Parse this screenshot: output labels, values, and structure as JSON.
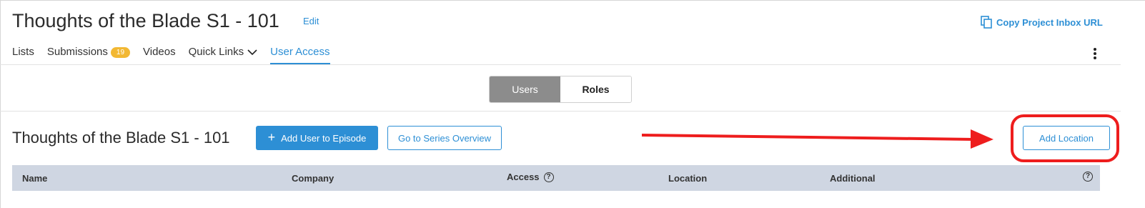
{
  "header": {
    "title": "Thoughts of the Blade S1 - 101",
    "edit_label": "Edit",
    "copy_label": "Copy Project Inbox URL",
    "copy_icon": "copy-icon"
  },
  "tabs": [
    {
      "label": "Lists"
    },
    {
      "label": "Submissions",
      "badge": "19"
    },
    {
      "label": "Videos"
    },
    {
      "label": "Quick Links"
    },
    {
      "label": "User Access",
      "active": true
    }
  ],
  "segmented": {
    "users_label": "Users",
    "roles_label": "Roles",
    "selected": "Users"
  },
  "episode": {
    "title": "Thoughts of the Blade S1 - 101",
    "add_user_label": "Add User to Episode",
    "series_label": "Go to Series Overview",
    "add_location_label": "Add Location"
  },
  "table": {
    "columns": [
      "Name",
      "Company",
      "Access",
      "Location",
      "Additional"
    ]
  },
  "colors": {
    "accent": "#2d8fd5",
    "badge": "#f2b833",
    "table_header": "#cfd6e2",
    "annotation": "#ee1d1d"
  }
}
